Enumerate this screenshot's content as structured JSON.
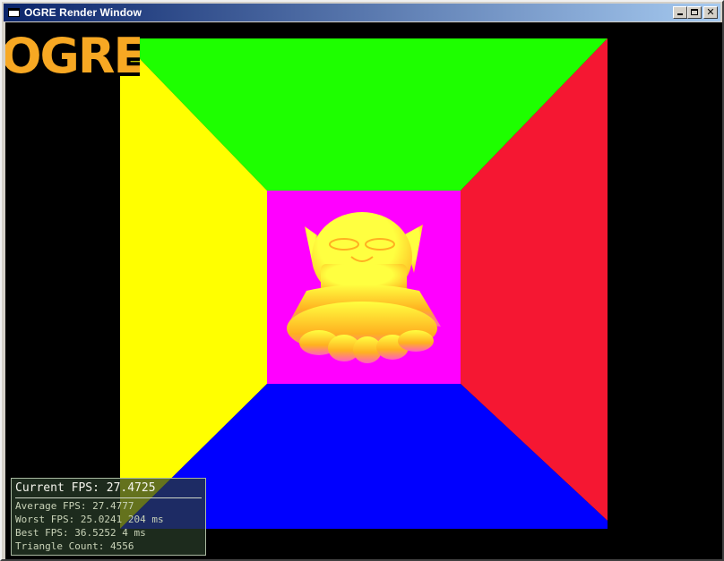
{
  "window": {
    "title": "OGRE Render Window"
  },
  "scene": {
    "colors": {
      "top_wall": "#1eff00",
      "left_wall": "#ffff00",
      "right_wall": "#f51732",
      "floor": "#0000ff",
      "back_wall": "#ff00ff",
      "background": "#000000",
      "model_highlight": "#ffff40",
      "model_mid": "#ffb020",
      "model_shadow": "#ff60c0"
    }
  },
  "stats": {
    "current_fps": "Current FPS: 27.4725",
    "average_fps": "Average FPS: 27.4777",
    "worst_fps": "Worst FPS: 25.0241 204 ms",
    "best_fps": "Best FPS: 36.5252 4 ms",
    "triangle_count": "Triangle Count: 4556"
  },
  "logo": {
    "text": "OGRE",
    "fill": "#f7a823",
    "stroke": "#000000"
  }
}
